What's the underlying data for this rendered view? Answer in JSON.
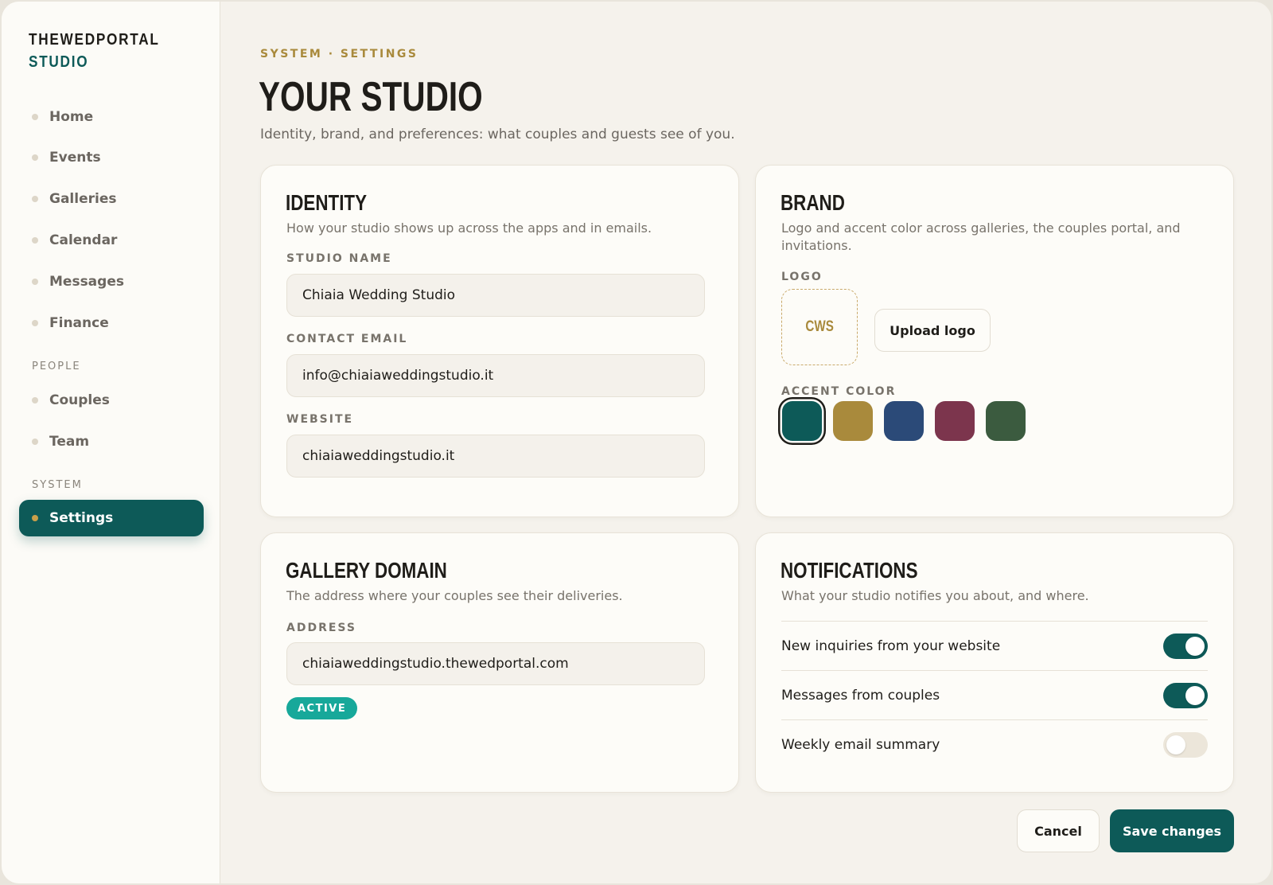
{
  "brand": {
    "line1": "THEWEDPORTAL",
    "line2": "STUDIO"
  },
  "sidebar": {
    "items": [
      {
        "label": "Home"
      },
      {
        "label": "Events"
      },
      {
        "label": "Galleries"
      },
      {
        "label": "Calendar"
      },
      {
        "label": "Messages"
      },
      {
        "label": "Finance"
      }
    ],
    "people_header": "PEOPLE",
    "people_items": [
      {
        "label": "Couples"
      },
      {
        "label": "Team"
      }
    ],
    "system_header": "SYSTEM",
    "system_items": [
      {
        "label": "Settings",
        "active": true
      }
    ]
  },
  "header": {
    "breadcrumb": "SYSTEM · SETTINGS",
    "title": "YOUR STUDIO",
    "subtitle": "Identity, brand, and preferences: what couples and guests see of you."
  },
  "identity": {
    "title": "IDENTITY",
    "desc": "How your studio shows up across the apps and in emails.",
    "studio_name_label": "STUDIO NAME",
    "studio_name": "Chiaia Wedding Studio",
    "email_label": "CONTACT EMAIL",
    "email": "info@chiaiaweddingstudio.it",
    "website_label": "WEBSITE",
    "website": "chiaiaweddingstudio.it"
  },
  "brand_card": {
    "title": "BRAND",
    "desc_line1": "Logo and accent color across galleries, the couples portal, and",
    "desc_line2": "invitations.",
    "logo_label": "LOGO",
    "logo_text": "CWS",
    "upload_label": "Upload logo",
    "accent_label": "ACCENT COLOR",
    "swatches": [
      "#0d5a58",
      "#a98a3c",
      "#2b4a78",
      "#7c354d",
      "#3b5b3f"
    ],
    "selected_swatch": 0
  },
  "domain": {
    "title": "GALLERY DOMAIN",
    "desc": "The address where your couples see their deliveries.",
    "address_label": "ADDRESS",
    "address": "chiaiaweddingstudio.thewedportal.com",
    "status": "ACTIVE"
  },
  "notifications": {
    "title": "NOTIFICATIONS",
    "desc": "What your studio notifies you about, and where.",
    "rows": [
      {
        "label": "New inquiries from your website",
        "on": true
      },
      {
        "label": "Messages from couples",
        "on": true
      },
      {
        "label": "Weekly email summary",
        "on": false
      }
    ]
  },
  "actions": {
    "cancel": "Cancel",
    "save": "Save changes"
  },
  "colors": {
    "accent": "#0d5a58",
    "gold": "#a98a3c",
    "active_badge": "#17a89a"
  }
}
